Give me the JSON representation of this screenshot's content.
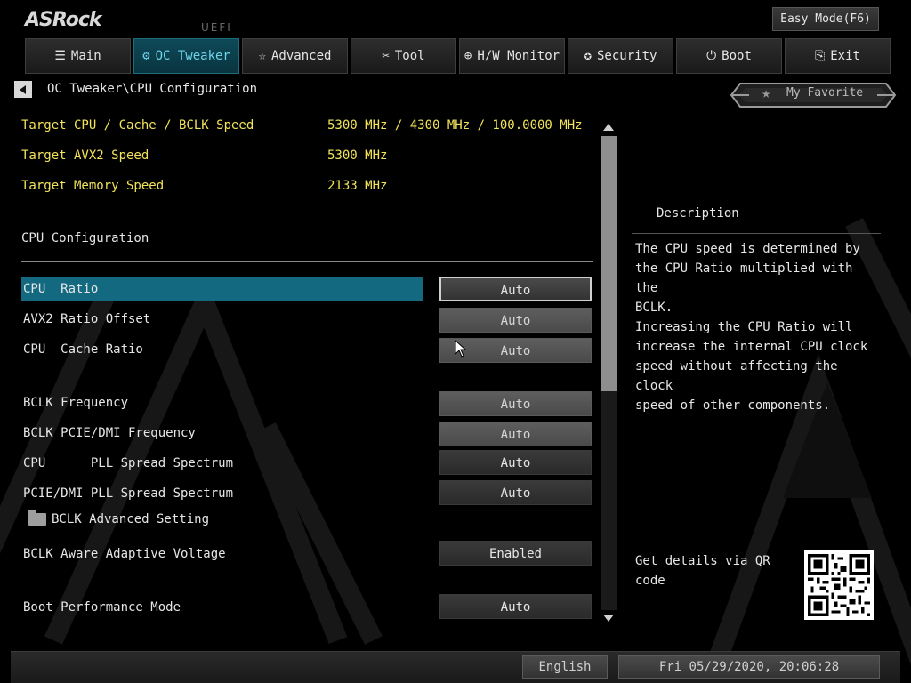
{
  "header": {
    "logo": "ASRock",
    "uefi": "UEFI",
    "easy_mode": "Easy Mode(F6)"
  },
  "tabs": [
    {
      "label": "Main",
      "icon": "list-icon"
    },
    {
      "label": "OC Tweaker",
      "icon": "rocket-icon",
      "active": true
    },
    {
      "label": "Advanced",
      "icon": "star-icon"
    },
    {
      "label": "Tool",
      "icon": "tools-icon"
    },
    {
      "label": "H/W Monitor",
      "icon": "crosshair-icon"
    },
    {
      "label": "Security",
      "icon": "shield-icon"
    },
    {
      "label": "Boot",
      "icon": "power-icon"
    },
    {
      "label": "Exit",
      "icon": "exit-door-icon"
    }
  ],
  "breadcrumb": "OC Tweaker\\CPU Configuration",
  "favorite": "My Favorite",
  "info": [
    {
      "label": "Target CPU / Cache / BCLK Speed",
      "value": "5300 MHz / 4300 MHz / 100.0000 MHz"
    },
    {
      "label": "Target AVX2 Speed",
      "value": "5300 MHz"
    },
    {
      "label": "Target Memory Speed",
      "value": "2133 MHz"
    }
  ],
  "section_title": "CPU Configuration",
  "options": [
    {
      "label": "CPU  Ratio",
      "value": "Auto"
    },
    {
      "label": "AVX2 Ratio Offset",
      "value": "Auto"
    },
    {
      "label": "CPU  Cache Ratio",
      "value": "Auto"
    },
    {
      "label": "BCLK Frequency",
      "value": "Auto"
    },
    {
      "label": "BCLK PCIE/DMI Frequency",
      "value": "Auto"
    },
    {
      "label": "CPU      PLL Spread Spectrum",
      "value": "Auto"
    },
    {
      "label": "PCIE/DMI PLL Spread Spectrum",
      "value": "Auto"
    },
    {
      "label": "BCLK Aware Adaptive Voltage",
      "value": "Enabled"
    },
    {
      "label": "Boot Performance Mode",
      "value": "Auto"
    }
  ],
  "submenu": {
    "label": "BCLK Advanced Setting",
    "icon": "folder-icon"
  },
  "description": {
    "title": "Description",
    "text": "The CPU speed is determined by\nthe CPU Ratio multiplied with the\nBCLK.\nIncreasing the CPU Ratio will\nincrease the internal CPU clock\nspeed without affecting the clock\nspeed of other components."
  },
  "qr_text": "Get details via QR code",
  "footer": {
    "language": "English",
    "datetime": "Fri 05/29/2020, 20:06:28"
  },
  "colors": {
    "accent": "#136a80",
    "active_tab_text": "#6fd3ea",
    "info_text": "#f2e35a"
  }
}
